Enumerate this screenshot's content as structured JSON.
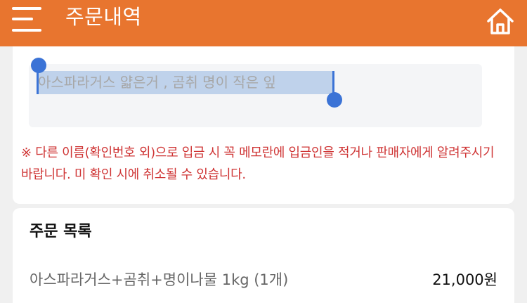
{
  "header": {
    "title": "주문내역",
    "menu_icon": "hamburger-menu-icon",
    "home_icon": "home-icon",
    "bg_color": "#e8752f"
  },
  "memo": {
    "text": "아스파라거스 얇은거 , 곰취 명이 작은 잎",
    "selected": true
  },
  "notice": {
    "text": "※ 다른 이름(확인번호 외)으로 입금 시 꼭 메모란에 입금인을 적거나 판매자에게 알려주시기 바랍니다. 미 확인 시에 취소될 수 있습니다.",
    "color": "#cf3434"
  },
  "order_list": {
    "title": "주문 목록",
    "items": [
      {
        "name": "아스파라거스+곰취+명이나물 1kg (1개)",
        "price": "21,000원"
      }
    ]
  }
}
